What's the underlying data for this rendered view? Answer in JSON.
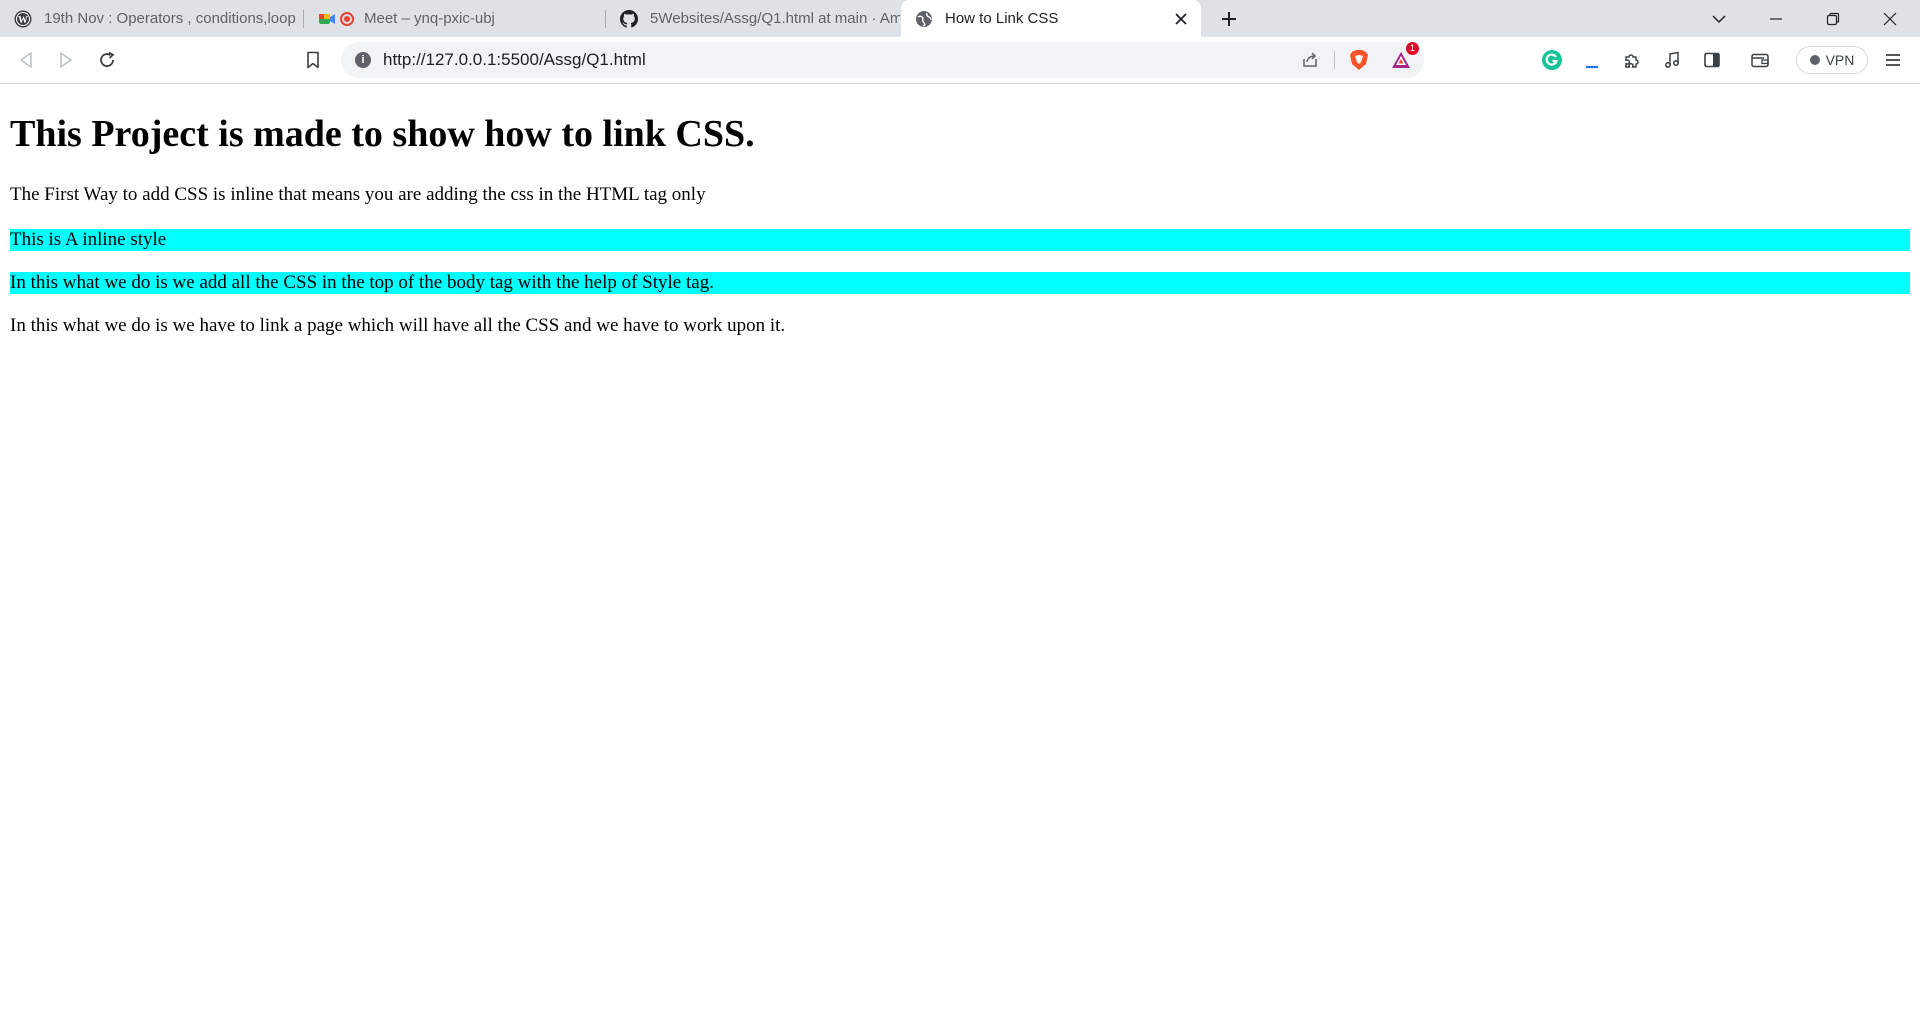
{
  "browser": {
    "tabs": [
      {
        "title": "19th Nov : Operators , conditions,loop",
        "icon": "wordpress-icon",
        "active": false
      },
      {
        "title": "Meet – ynq-pxic-ubj",
        "icon": "google-meet-icon",
        "active": false
      },
      {
        "title": "5Websites/Assg/Q1.html at main · Am",
        "icon": "github-icon",
        "active": false
      },
      {
        "title": "How to Link CSS",
        "icon": "globe-icon",
        "active": true
      }
    ],
    "address_bar": {
      "url": "http://127.0.0.1:5500/Assg/Q1.html"
    },
    "rewards_badge_count": "1",
    "vpn_label": "VPN"
  },
  "page": {
    "heading": "This Project is made to show how to link CSS.",
    "paragraphs": {
      "intro": "The First Way to add CSS is inline that means you are adding the css in the HTML tag only",
      "inline": "This is A inline style",
      "internal": "In this what we do is we add all the CSS in the top of the body tag with the help of Style tag.",
      "external": "In this what we do is we have to link a page which will have all the CSS and we have to work upon it."
    },
    "highlight_color": "#00ffff"
  }
}
